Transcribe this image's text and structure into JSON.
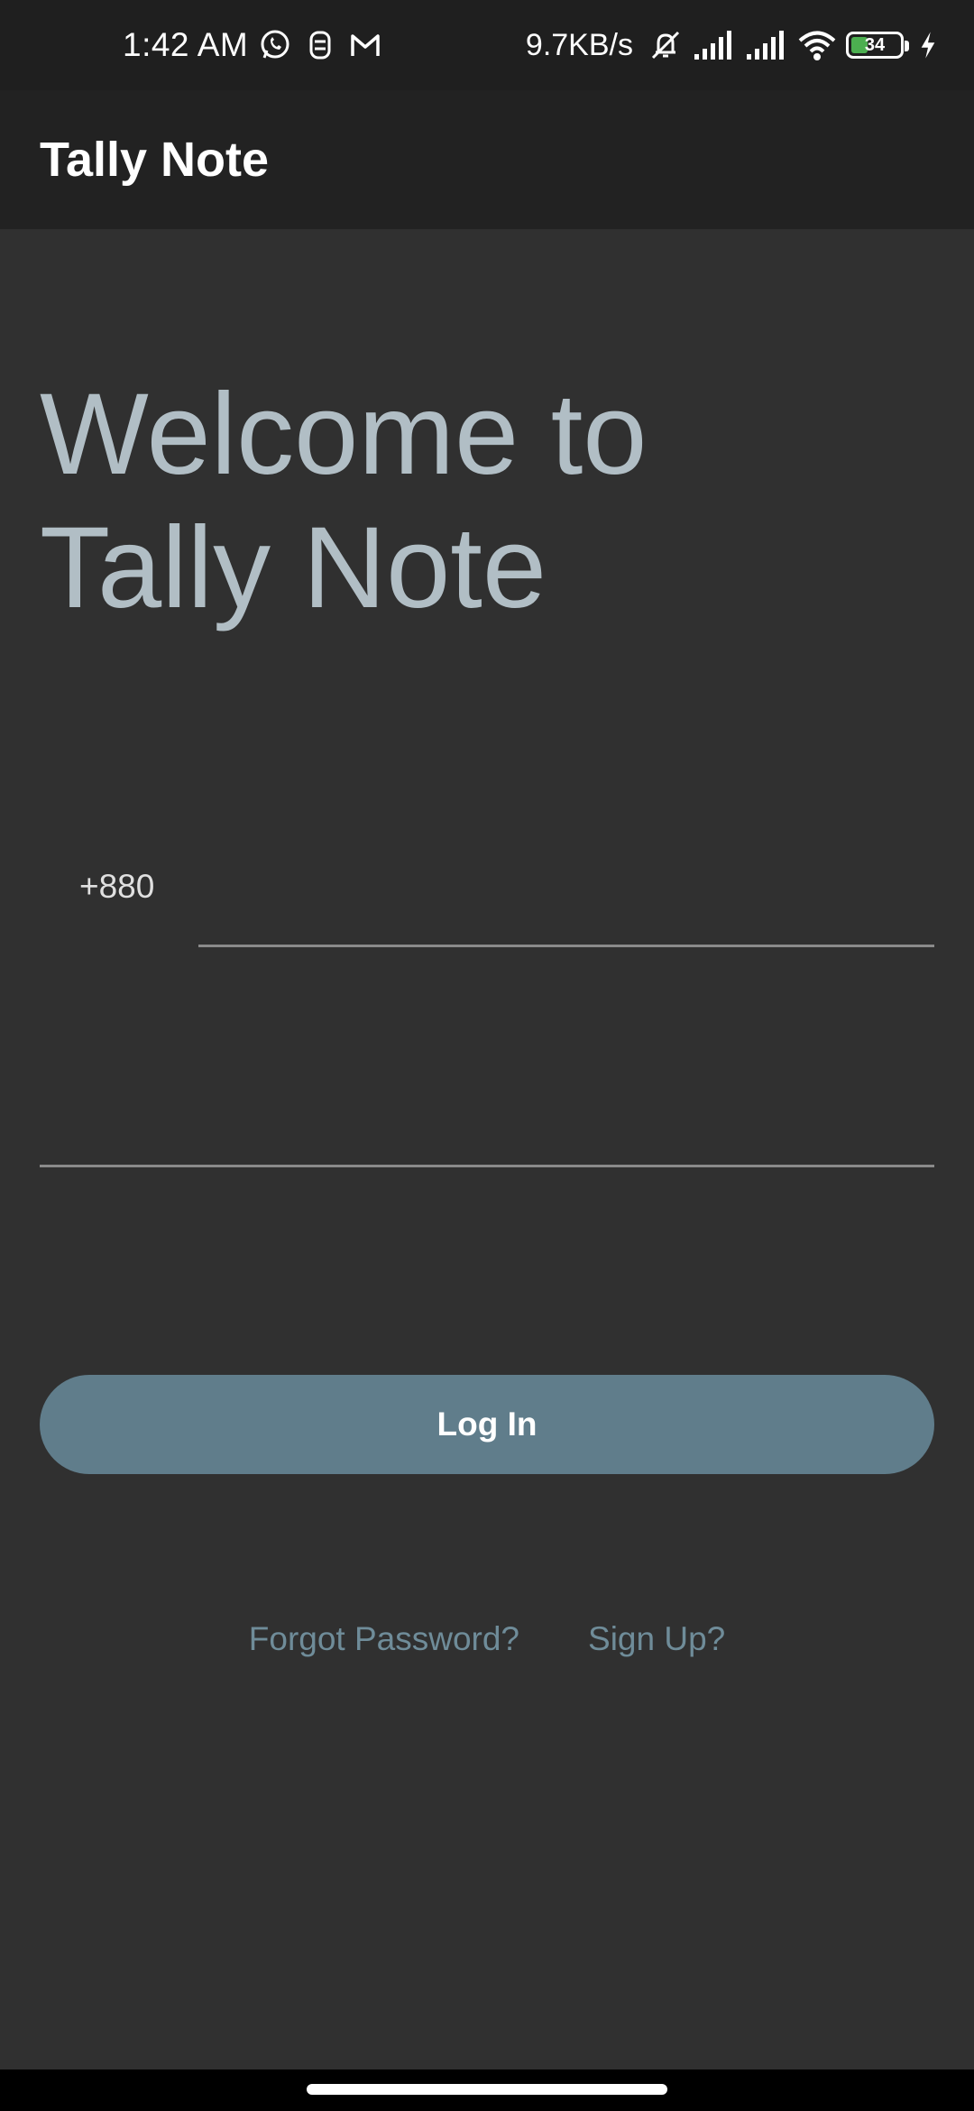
{
  "status_bar": {
    "time": "1:42 AM",
    "left_icons": [
      "whatsapp-icon",
      "notification-app-icon",
      "gmail-icon"
    ],
    "network_speed": "9.7KB/s",
    "right_icons": [
      "mute-bell-icon",
      "signal-bars-icon",
      "signal-bars-icon",
      "wifi-icon",
      "battery-icon",
      "charging-bolt-icon"
    ],
    "battery_level": "34",
    "battery_fraction": 0.34
  },
  "app_bar": {
    "title": "Tally Note"
  },
  "welcome": {
    "line1": "Welcome to",
    "line2": "Tally Note"
  },
  "login_form": {
    "country_code": "+880",
    "phone_value": "",
    "password_value": "",
    "login_label": "Log In"
  },
  "links": {
    "forgot_password": "Forgot Password?",
    "sign_up": "Sign Up?"
  },
  "colors": {
    "background": "#303030",
    "app_bar": "#222222",
    "status_bar": "#1f1f1f",
    "welcome_text": "#b1bec5",
    "button": "#607d8b",
    "link": "#6f8c99",
    "battery_fill": "#4caf50"
  }
}
